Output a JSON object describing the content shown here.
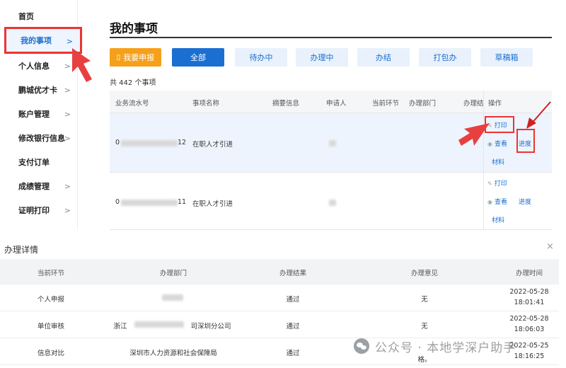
{
  "sidebar": {
    "items": [
      {
        "label": "首页",
        "chevron": ""
      },
      {
        "label": "我的事项",
        "chevron": ">"
      },
      {
        "label": "个人信息",
        "chevron": ">"
      },
      {
        "label": "鹏城优才卡",
        "chevron": ">"
      },
      {
        "label": "账户管理",
        "chevron": ">"
      },
      {
        "label": "修改银行信息",
        "chevron": ">"
      },
      {
        "label": "支付订单",
        "chevron": ""
      },
      {
        "label": "成绩管理",
        "chevron": ">"
      },
      {
        "label": "证明打印",
        "chevron": ">"
      }
    ],
    "active_index": 1
  },
  "main": {
    "title": "我的事项",
    "tabs": [
      {
        "label": "我要申报",
        "icon": "document-icon"
      },
      {
        "label": "全部"
      },
      {
        "label": "待办中"
      },
      {
        "label": "办理中"
      },
      {
        "label": "办结"
      },
      {
        "label": "打包办"
      },
      {
        "label": "草稿箱"
      }
    ],
    "count_text": "共 442 个事项",
    "columns": [
      "业务流水号",
      "事项名称",
      "摘要信息",
      "申请人",
      "当前环节",
      "办理部门",
      "办理结",
      "操作"
    ],
    "rows": [
      {
        "serial_suffix": "12",
        "serial_prefix": "0",
        "item": "在职人才引进",
        "ops": {
          "print": "打印",
          "view": "查看",
          "progress": "进度",
          "material": "材料"
        }
      },
      {
        "serial_suffix": "11",
        "serial_prefix": "0",
        "item": "在职人才引进",
        "ops": {
          "print": "打印",
          "view": "查看",
          "progress": "进度",
          "material": "材料"
        }
      }
    ]
  },
  "detail": {
    "title": "办理详情",
    "close": "×",
    "columns": [
      "当前环节",
      "办理部门",
      "办理结果",
      "办理意见",
      "办理时间"
    ],
    "rows": [
      {
        "stage": "个人申报",
        "dept": "",
        "result": "通过",
        "opinion": "无",
        "date": "2022-05-28",
        "time": "18:01:41"
      },
      {
        "stage": "单位审核",
        "dept_prefix": "浙江",
        "dept": "司深圳分公司",
        "result": "通过",
        "opinion": "无",
        "date": "2022-05-28",
        "time": "18:06:03"
      },
      {
        "stage": "信息对比",
        "dept": "深圳市人力资源和社会保障局",
        "result": "通过",
        "opinion": "格。",
        "date": "2022-05-25",
        "time": "18:16:25"
      }
    ]
  },
  "watermark": {
    "text": "公众号 · 本地学深户助手",
    "icon": "wechat-icon"
  },
  "colors": {
    "accent": "#1a6fd1",
    "orange": "#f5a01a",
    "highlight": "#e33333"
  }
}
